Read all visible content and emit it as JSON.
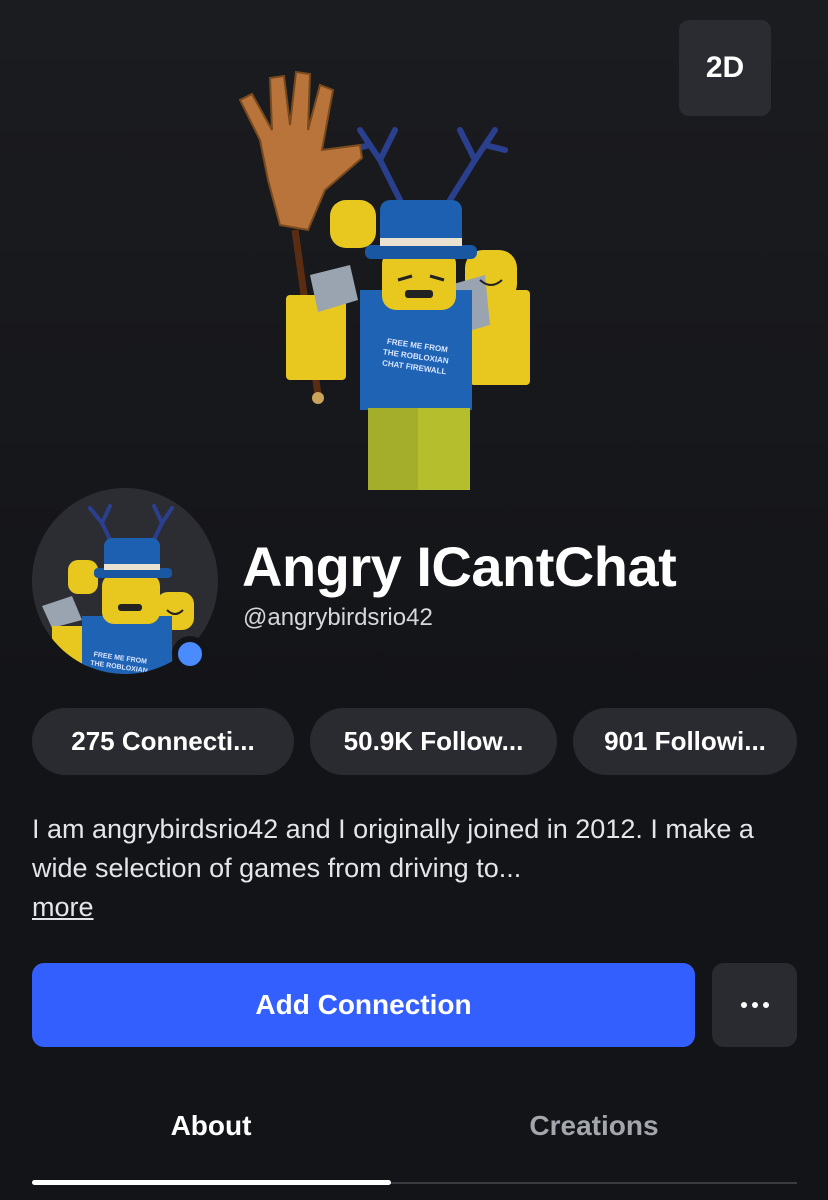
{
  "hero": {
    "view_toggle_label": "2D"
  },
  "profile": {
    "display_name": "Angry ICantChat",
    "username": "@angrybirdsrio42",
    "online": true,
    "shirt_text": "FREE ME FROM THE ROBLOXIAN CHAT FIREWALL",
    "headshot_shirt_text": "FREE ME FROM THE ROBLOXIAN"
  },
  "stats": {
    "connections": "275 Connecti...",
    "followers": "50.9K Follow...",
    "following": "901 Followi..."
  },
  "bio": {
    "text": "I am angrybirdsrio42 and I originally joined in 2012. I make a wide selection of games from driving to...",
    "more_label": "more"
  },
  "actions": {
    "primary_label": "Add Connection",
    "more_icon": "ellipsis-icon"
  },
  "tabs": [
    {
      "label": "About",
      "active": true
    },
    {
      "label": "Creations",
      "active": false
    }
  ],
  "colors": {
    "background": "#131418",
    "pill": "#2a2b30",
    "primary": "#335fff",
    "online": "#4a8cff",
    "inactive_tab": "#a4a6ad"
  }
}
